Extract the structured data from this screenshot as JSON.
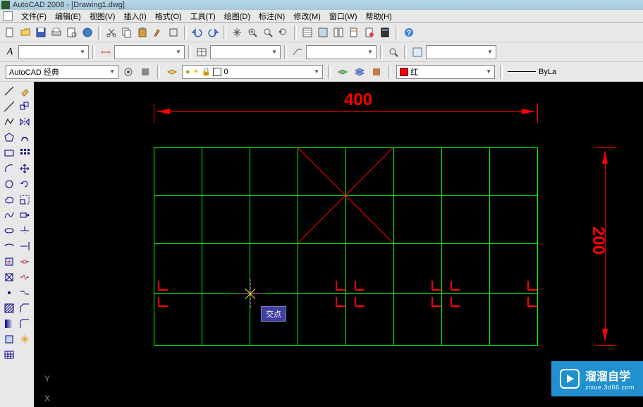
{
  "titlebar": {
    "title": "AutoCAD 2008 - [Drawing1.dwg]"
  },
  "menu": {
    "file": "文件(F)",
    "edit": "编辑(E)",
    "view": "视图(V)",
    "insert": "插入(I)",
    "format": "格式(O)",
    "tools": "工具(T)",
    "draw": "绘图(D)",
    "dimension": "标注(N)",
    "modify": "修改(M)",
    "window": "窗口(W)",
    "help": "帮助(H)"
  },
  "style_bar": {
    "style": "A",
    "font": "A"
  },
  "workspace": {
    "name": "AutoCAD 经典",
    "layer": "0",
    "color": "红",
    "lineweight": "ByLa"
  },
  "canvas": {
    "dim_horizontal": "400",
    "dim_vertical": "200",
    "tooltip": "交点",
    "ucs_y": "Y",
    "ucs_x": "X"
  },
  "watermark": {
    "brand": "溜溜自学",
    "url": "zixue.3d66.com"
  }
}
